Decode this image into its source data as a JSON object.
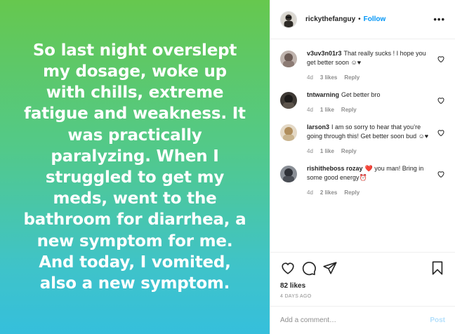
{
  "post": {
    "caption_lines": [
      "So last night overslept",
      "my dosage, woke up",
      "with chills, extreme",
      "fatigue and weakness. It",
      "was practically",
      "paralyzing. When I",
      "struggled to get my",
      "meds, went to the",
      "bathroom for diarrhea, a",
      "new symptom for me.",
      "And today, I vomited,",
      "also a new symptom."
    ]
  },
  "header": {
    "username": "rickythefanguy",
    "separator": "•",
    "follow_label": "Follow",
    "more_label": "•••"
  },
  "comments": [
    {
      "user": "v3uv3n01r3",
      "text": "That really sucks ! I hope you get better soon ☺♥",
      "age": "4d",
      "likes": "3 likes",
      "reply": "Reply"
    },
    {
      "user": "tntwarning",
      "text": "Get better bro",
      "age": "4d",
      "likes": "1 like",
      "reply": "Reply"
    },
    {
      "user": "larson3",
      "text": "I am so sorry to hear that you’re going through this! Get better soon bud ☺♥",
      "age": "4d",
      "likes": "1 like",
      "reply": "Reply"
    },
    {
      "user": "rishitheboss rozay",
      "text": "❤️ you man! Bring in some good energy⏰",
      "age": "4d",
      "likes": "2 likes",
      "reply": "Reply"
    }
  ],
  "actions": {
    "likes_count": "82 likes",
    "timestamp": "4 DAYS AGO"
  },
  "add_comment": {
    "placeholder": "Add a comment…",
    "post_label": "Post"
  },
  "colors": {
    "accent": "#0095f6",
    "post_disabled": "#b2dffc",
    "gradient_top": "#66c84e",
    "gradient_bottom": "#35bfdc"
  }
}
